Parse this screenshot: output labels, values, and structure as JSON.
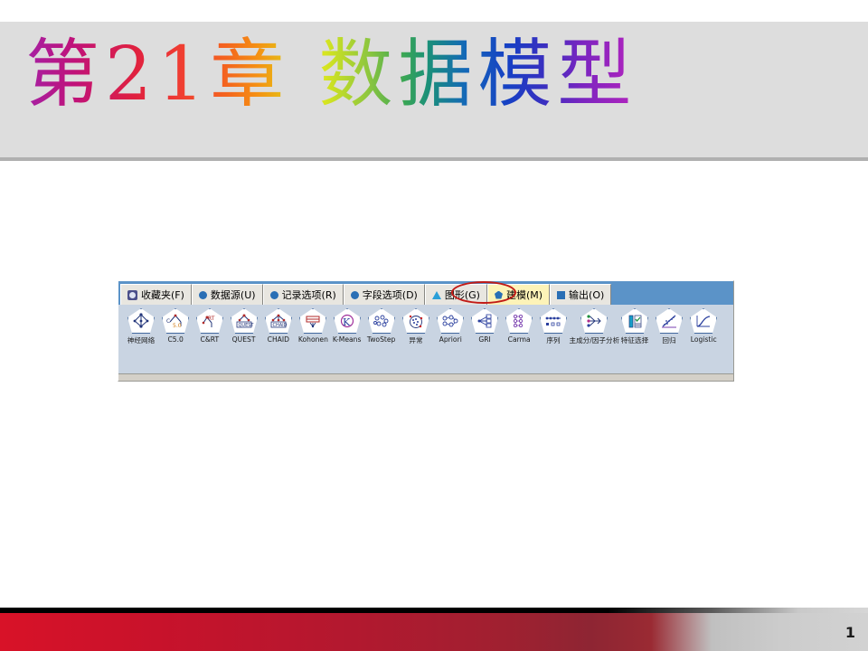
{
  "slide": {
    "title": "第21章  数据模型",
    "page_number": "1",
    "accent_colors": {
      "band_background": "#dddddd",
      "band_border": "#b0b0b0",
      "footer_red": "#c8122b",
      "footer_gray": "#cccccc",
      "highlight_ellipse": "#c21b17",
      "tab_selected_background": "#fdf3b8",
      "tab_strip_blue": "#5b93c8",
      "node_row_blue": "#c9d4e2"
    }
  },
  "palette": {
    "tabs": [
      {
        "label": "收藏夹(F)",
        "glyph": "favorites-icon",
        "selected": false
      },
      {
        "label": "数据源(U)",
        "glyph": "circle-icon",
        "selected": false
      },
      {
        "label": "记录选项(R)",
        "glyph": "circle-icon",
        "selected": false
      },
      {
        "label": "字段选项(D)",
        "glyph": "circle-icon",
        "selected": false
      },
      {
        "label": "图形(G)",
        "glyph": "triangle-icon",
        "selected": false
      },
      {
        "label": "建模(M)",
        "glyph": "pentagon-icon",
        "selected": true
      },
      {
        "label": "输出(O)",
        "glyph": "square-icon",
        "selected": false
      }
    ],
    "nodes": [
      {
        "label": "神经网络",
        "icon": "neural-network-node-icon"
      },
      {
        "label": "C5.0",
        "icon": "c50-node-icon"
      },
      {
        "label": "C&RT",
        "icon": "cart-node-icon"
      },
      {
        "label": "QUEST",
        "icon": "quest-node-icon"
      },
      {
        "label": "CHAID",
        "icon": "chaid-node-icon"
      },
      {
        "label": "Kohonen",
        "icon": "kohonen-node-icon"
      },
      {
        "label": "K-Means",
        "icon": "kmeans-node-icon"
      },
      {
        "label": "TwoStep",
        "icon": "twostep-node-icon"
      },
      {
        "label": "异常",
        "icon": "anomaly-node-icon"
      },
      {
        "label": "Apriori",
        "icon": "apriori-node-icon"
      },
      {
        "label": "GRI",
        "icon": "gri-node-icon"
      },
      {
        "label": "Carma",
        "icon": "carma-node-icon"
      },
      {
        "label": "序列",
        "icon": "sequence-node-icon"
      },
      {
        "label": "主成分/因子分析",
        "icon": "pca-factor-node-icon"
      },
      {
        "label": "特征选择",
        "icon": "feature-selection-node-icon"
      },
      {
        "label": "回归",
        "icon": "regression-node-icon"
      },
      {
        "label": "Logistic",
        "icon": "logistic-node-icon"
      }
    ]
  }
}
